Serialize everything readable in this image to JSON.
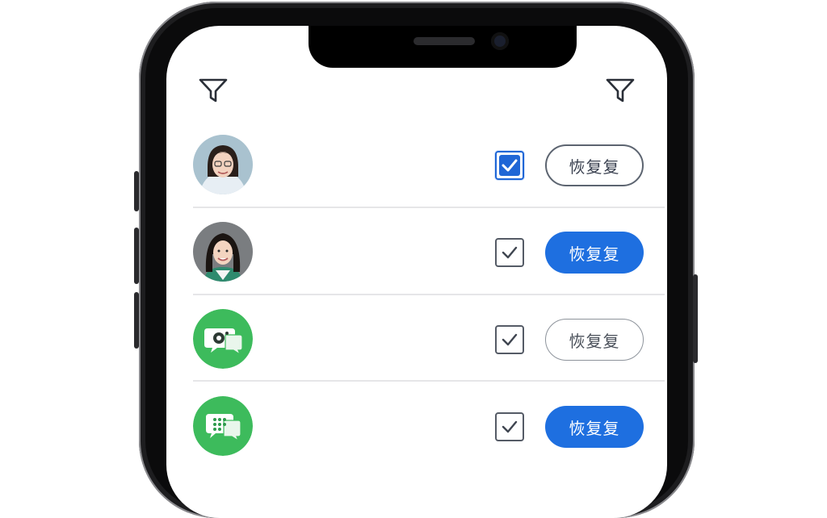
{
  "rows": [
    {
      "avatar": "woman-with-glasses-avatar",
      "checked": true,
      "button_label": "恢复复",
      "button_style": "outline"
    },
    {
      "avatar": "woman-long-hair-avatar",
      "checked": true,
      "button_label": "恢复复",
      "button_style": "filled"
    },
    {
      "avatar": "green-chat-camera-icon",
      "checked": true,
      "button_label": "恢复复",
      "button_style": "outline-light"
    },
    {
      "avatar": "green-chat-dots-icon",
      "checked": true,
      "button_label": "恢复复",
      "button_style": "filled"
    }
  ],
  "colors": {
    "accent": "#1e6fe0",
    "app_green": "#3dbb5c",
    "frame": "#1d1d1f"
  }
}
